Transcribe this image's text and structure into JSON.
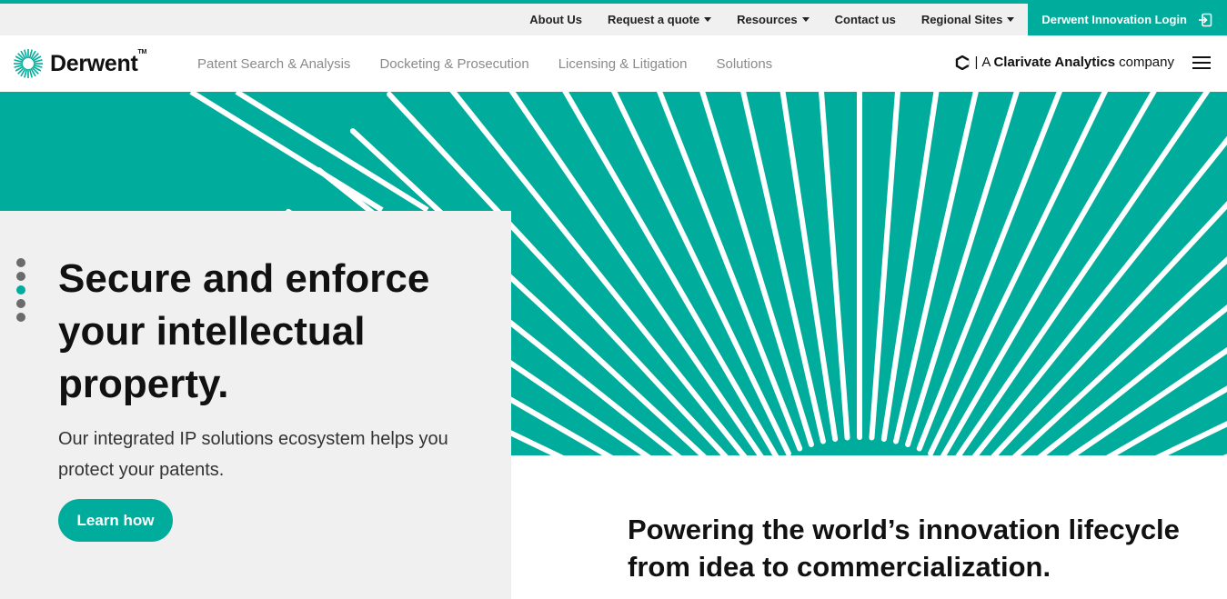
{
  "utility_nav": {
    "items": [
      {
        "label": "About Us",
        "has_dropdown": false
      },
      {
        "label": "Request a quote",
        "has_dropdown": true
      },
      {
        "label": "Resources",
        "has_dropdown": true
      },
      {
        "label": "Contact us",
        "has_dropdown": false
      },
      {
        "label": "Regional Sites",
        "has_dropdown": true
      }
    ],
    "login_label": "Derwent Innovation Login",
    "login_icon": "sign-in-icon"
  },
  "header": {
    "logo_text": "Derwent",
    "logo_tm": "TM",
    "logo_icon": "derwent-sunburst-logo",
    "nav": [
      {
        "label": "Patent Search & Analysis"
      },
      {
        "label": "Docketing & Prosecution"
      },
      {
        "label": "Licensing & Litigation"
      },
      {
        "label": "Solutions"
      }
    ],
    "company": {
      "prefix": "A",
      "name": "Clarivate Analytics",
      "suffix": "company",
      "icon": "clarivate-logo-icon"
    },
    "menu_icon": "hamburger-menu-icon"
  },
  "hero": {
    "title": "Secure and enforce your intellectual property.",
    "subtitle": "Our integrated IP solutions ecosystem helps you protect your patents.",
    "cta_label": "Learn how",
    "slides_count": 5,
    "active_slide": 3
  },
  "tagline": "Powering the world’s innovation lifecycle from idea to commercialization.",
  "colors": {
    "accent": "#00ad9c",
    "utility_bg": "#f0f0f0",
    "text": "#111111",
    "nav_text": "#8a8a8a"
  }
}
